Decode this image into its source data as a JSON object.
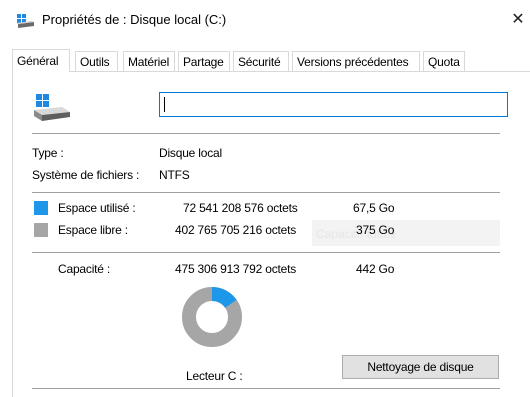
{
  "window": {
    "title": "Propriétés de : Disque local (C:)",
    "close_glyph": "✕",
    "title_icon": "drive-icon"
  },
  "tabs": [
    {
      "label": "Général",
      "active": true
    },
    {
      "label": "Outils",
      "active": false
    },
    {
      "label": "Matériel",
      "active": false
    },
    {
      "label": "Partage",
      "active": false
    },
    {
      "label": "Sécurité",
      "active": false
    },
    {
      "label": "Versions précédentes",
      "active": false
    },
    {
      "label": "Quota",
      "active": false
    }
  ],
  "general": {
    "drive_icon": "drive-icon",
    "name_value": "",
    "type": {
      "label": "Type :",
      "value": "Disque local"
    },
    "filesystem": {
      "label": "Système de fichiers :",
      "value": "NTFS"
    },
    "used": {
      "label": "Espace utilisé :",
      "bytes": "72 541 208 576 octets",
      "size": "67,5 Go",
      "color": "#1c97ea"
    },
    "free": {
      "label": "Espace libre :",
      "bytes": "402 765 705 216 octets",
      "size": "375 Go",
      "color": "#a6a6a6"
    },
    "capacity": {
      "label": "Capacité :",
      "bytes": "475 306 913 792 octets",
      "size": "442 Go"
    },
    "ghost_text": "Capacité totale",
    "drive_label": "Lecteur C :",
    "cleanup_button": "Nettoyage de disque",
    "used_fraction": 0.1526
  }
}
